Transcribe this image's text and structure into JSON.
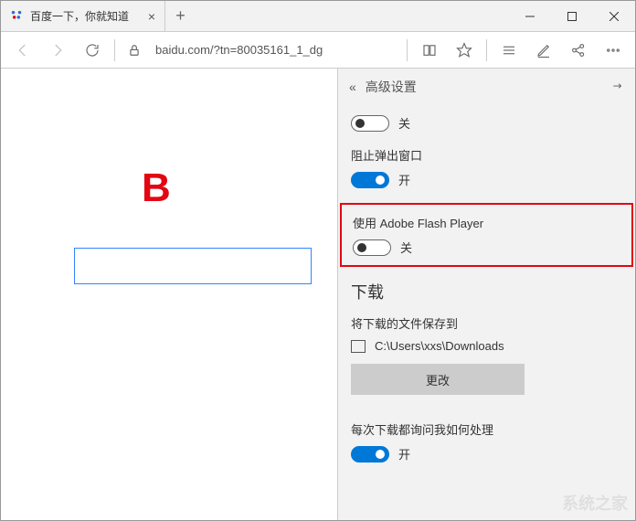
{
  "tab": {
    "title": "百度一下，你就知道"
  },
  "url": "baidu.com/?tn=80035161_1_dg",
  "page": {
    "logo_fragment": "B"
  },
  "panel": {
    "title": "高级设置",
    "toggle1_state": "关",
    "block_popup_label": "阻止弹出窗口",
    "block_popup_state": "开",
    "flash_label": "使用 Adobe Flash Player",
    "flash_state": "关",
    "download_section": "下载",
    "download_path_label": "将下载的文件保存到",
    "download_path": "C:\\Users\\xxs\\Downloads",
    "change_button": "更改",
    "ask_each_label": "每次下载都询问我如何处理",
    "ask_each_state": "开"
  },
  "watermark": "系统之家"
}
